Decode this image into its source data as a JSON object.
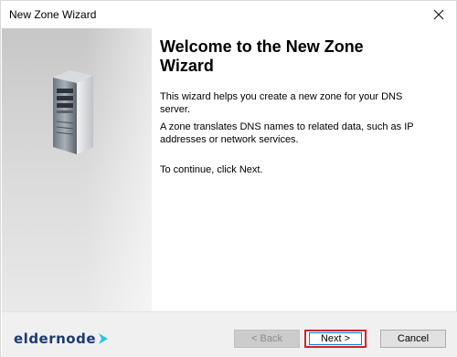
{
  "window": {
    "title": "New Zone Wizard"
  },
  "content": {
    "heading": "Welcome to the New Zone Wizard",
    "paragraph1": "This wizard helps you create a new zone for your DNS server.",
    "paragraph2": "A zone translates DNS names to related data, such as IP addresses or network services.",
    "paragraph3": "To continue, click Next."
  },
  "icons": {
    "server": "server-icon",
    "close": "close-icon",
    "logo_arrow": "arrow-icon"
  },
  "logo": {
    "text": "eldernode"
  },
  "buttons": {
    "back": "< Back",
    "next": "Next >",
    "cancel": "Cancel"
  },
  "colors": {
    "highlight": "#d6202a",
    "logo_blue": "#1b3a73",
    "logo_cyan": "#2bc3ea"
  }
}
